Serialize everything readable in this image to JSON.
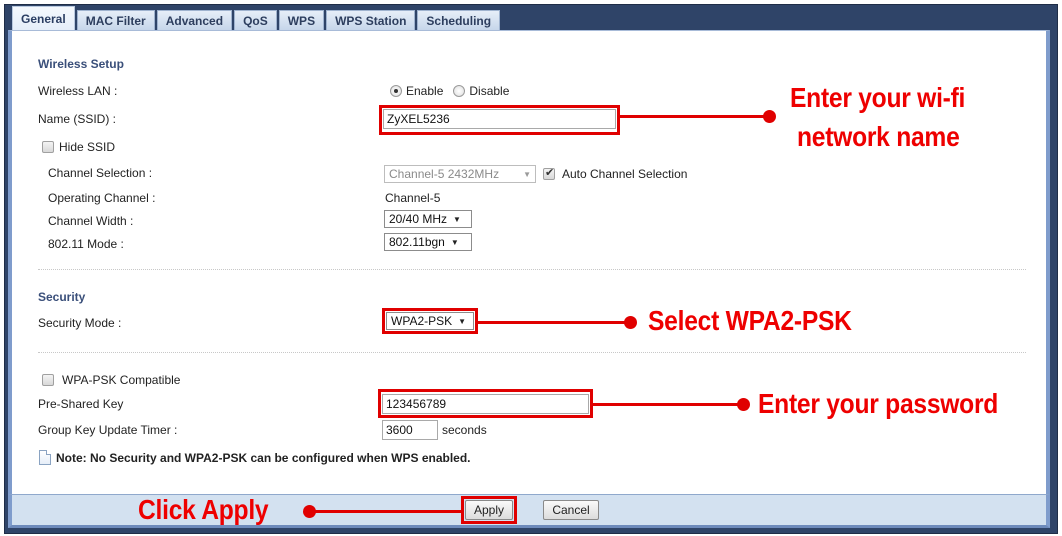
{
  "tabs": [
    {
      "label": "General",
      "active": true
    },
    {
      "label": "MAC Filter",
      "active": false
    },
    {
      "label": "Advanced",
      "active": false
    },
    {
      "label": "QoS",
      "active": false
    },
    {
      "label": "WPS",
      "active": false
    },
    {
      "label": "WPS Station",
      "active": false
    },
    {
      "label": "Scheduling",
      "active": false
    }
  ],
  "wireless_setup": {
    "title": "Wireless Setup",
    "wireless_lan_label": "Wireless LAN :",
    "enable_label": "Enable",
    "disable_label": "Disable",
    "wireless_lan_value": "Enable",
    "ssid_label": "Name (SSID) :",
    "ssid_value": "ZyXEL5236",
    "hide_ssid_label": "Hide SSID",
    "hide_ssid_checked": false,
    "channel_selection_label": "Channel Selection :",
    "channel_selection_value": "Channel-5 2432MHz",
    "auto_channel_label": "Auto Channel Selection",
    "auto_channel_checked": true,
    "operating_channel_label": "Operating Channel :",
    "operating_channel_value": "Channel-5",
    "channel_width_label": "Channel Width :",
    "channel_width_value": "20/40 MHz",
    "mode_label": "802.11 Mode :",
    "mode_value": "802.11bgn"
  },
  "security": {
    "title": "Security",
    "mode_label": "Security Mode :",
    "mode_value": "WPA2-PSK",
    "wpa_psk_compatible_label": "WPA-PSK Compatible",
    "wpa_psk_compatible_checked": false,
    "psk_label": "Pre-Shared Key",
    "psk_value": "123456789",
    "group_key_label": "Group Key Update Timer :",
    "group_key_value": "3600",
    "group_key_unit": "seconds",
    "note": "Note: No Security and WPA2-PSK can be configured when WPS enabled."
  },
  "footer": {
    "apply_label": "Apply",
    "cancel_label": "Cancel"
  },
  "annotations": {
    "ssid_line1": "Enter your wi-fi",
    "ssid_line2": "network name",
    "security": "Select WPA2-PSK",
    "password": "Enter your password",
    "apply": "Click Apply",
    "color": "#e00000"
  }
}
